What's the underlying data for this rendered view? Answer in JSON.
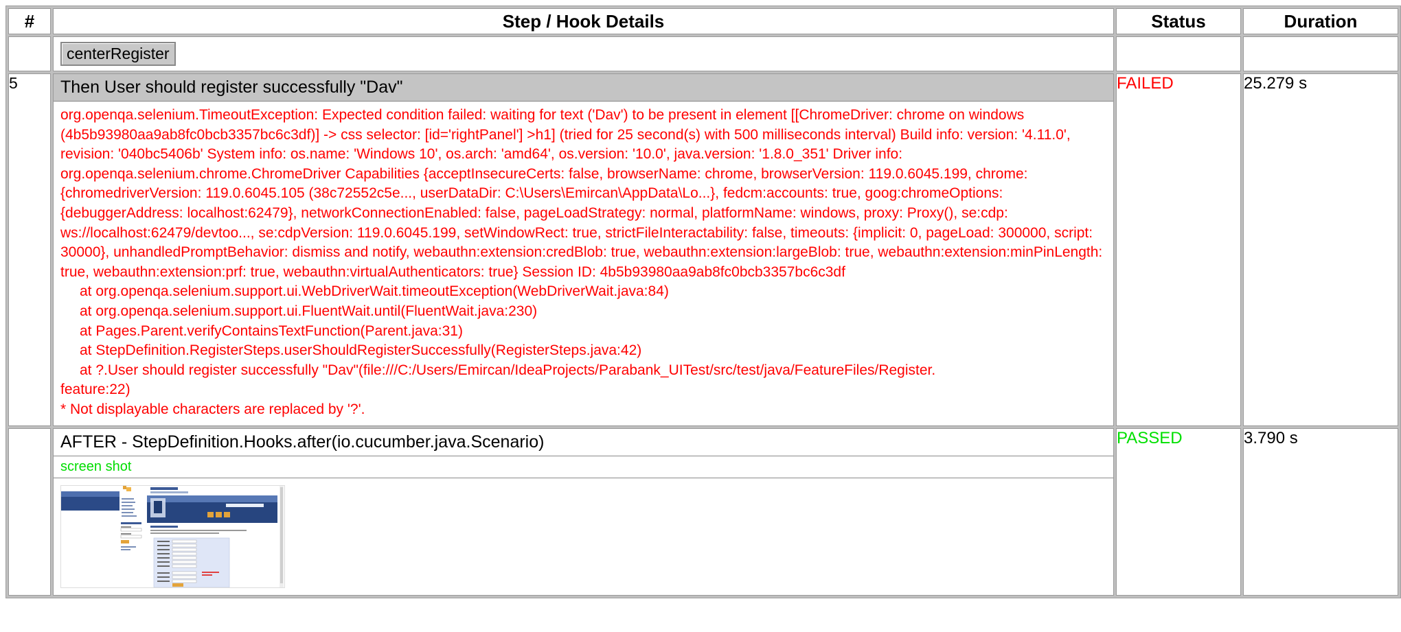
{
  "table": {
    "headers": {
      "num": "#",
      "details": "Step / Hook Details",
      "status": "Status",
      "duration": "Duration"
    }
  },
  "rows": {
    "tag_row": {
      "tag_label": "centerRegister"
    },
    "step_row": {
      "number": "5",
      "title": "Then User should register successfully \"Dav\"",
      "status": "FAILED",
      "duration": "25.279 s",
      "error_message": "org.openqa.selenium.TimeoutException: Expected condition failed: waiting for text ('Dav') to be present in element [[ChromeDriver: chrome on windows (4b5b93980aa9ab8fc0bcb3357bc6c3df)] -> css selector: [id='rightPanel'] >h1] (tried for 25 second(s) with 500 milliseconds interval) Build info: version: '4.11.0', revision: '040bc5406b' System info: os.name: 'Windows 10', os.arch: 'amd64', os.version: '10.0', java.version: '1.8.0_351' Driver info: org.openqa.selenium.chrome.ChromeDriver Capabilities {acceptInsecureCerts: false, browserName: chrome, browserVersion: 119.0.6045.199, chrome: {chromedriverVersion: 119.0.6045.105 (38c72552c5e..., userDataDir: C:\\Users\\Emircan\\AppData\\Lo...}, fedcm:accounts: true, goog:chromeOptions: {debuggerAddress: localhost:62479}, networkConnectionEnabled: false, pageLoadStrategy: normal, platformName: windows, proxy: Proxy(), se:cdp: ws://localhost:62479/devtoo..., se:cdpVersion: 119.0.6045.199, setWindowRect: true, strictFileInteractability: false, timeouts: {implicit: 0, pageLoad: 300000, script: 30000}, unhandledPromptBehavior: dismiss and notify, webauthn:extension:credBlob: true, webauthn:extension:largeBlob: true, webauthn:extension:minPinLength: true, webauthn:extension:prf: true, webauthn:virtualAuthenticators: true} Session ID: 4b5b93980aa9ab8fc0bcb3357bc6c3df",
      "stack_trace": [
        "at org.openqa.selenium.support.ui.WebDriverWait.timeoutException(WebDriverWait.java:84)",
        "at org.openqa.selenium.support.ui.FluentWait.until(FluentWait.java:230)",
        "at Pages.Parent.verifyContainsTextFunction(Parent.java:31)",
        "at StepDefinition.RegisterSteps.userShouldRegisterSuccessfully(RegisterSteps.java:42)"
      ],
      "trace_last_line_a": "at ?.User should register successfully \"Dav\"(file:///C:/Users/Emircan/IdeaProjects/Parabank_UITest/src/test/java/FeatureFiles/Register.",
      "trace_last_line_b": "feature:22)",
      "footnote": "* Not displayable characters are replaced by '?'."
    },
    "hook_row": {
      "number": "",
      "title": "AFTER - StepDefinition.Hooks.after(io.cucumber.java.Scenario)",
      "status": "PASSED",
      "duration": "3.790 s",
      "embed_label": "screen shot"
    }
  },
  "colors": {
    "failed": "#ff0000",
    "passed": "#00e000",
    "step_header_bg": "#c4c4c4"
  }
}
